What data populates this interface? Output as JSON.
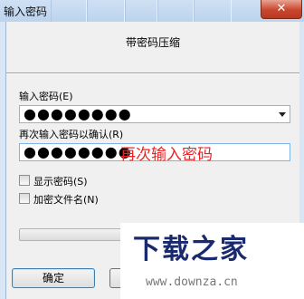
{
  "window": {
    "title": "输入密码",
    "close_label": "✕"
  },
  "dialog": {
    "title": "带密码压缩"
  },
  "password": {
    "label": "输入密码(E)",
    "value": "●●●●●●●●"
  },
  "confirm": {
    "label": "再次输入密码以确认(R)",
    "value": "●●●●●●●●",
    "annotation": "再次输入密码"
  },
  "options": {
    "show_password": "显示密码(S)",
    "encrypt_filenames": "加密文件名(N)"
  },
  "buttons": {
    "ok": "确定"
  },
  "watermark": {
    "title": "下载之家",
    "url": "www.downza.cn"
  }
}
